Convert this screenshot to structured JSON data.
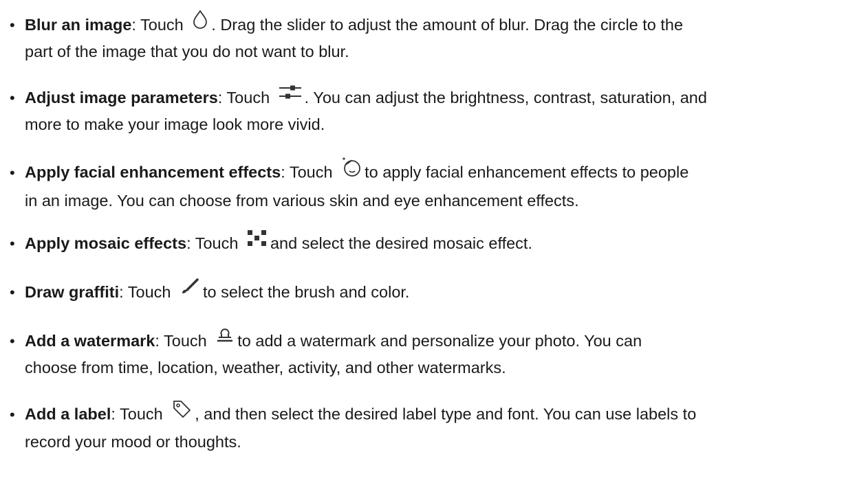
{
  "items": [
    {
      "title": "Blur an image",
      "before_icon": ": Touch",
      "icon": "droplet-icon",
      "after_icon": ". Drag the slider to adjust the amount of blur. Drag the circle to the",
      "continuation": "part of the image that you do not want to blur."
    },
    {
      "title": "Adjust image parameters",
      "before_icon": ": Touch",
      "icon": "sliders-icon",
      "after_icon": ". You can adjust the brightness, contrast, saturation, and",
      "continuation": "more to make your image look more vivid."
    },
    {
      "title": "Apply facial enhancement effects",
      "before_icon": ": Touch",
      "icon": "face-enhance-icon",
      "after_icon": "to apply facial enhancement effects to people",
      "continuation": "in an image. You can choose from various skin and eye enhancement effects."
    },
    {
      "title": "Apply mosaic effects",
      "before_icon": ": Touch",
      "icon": "mosaic-icon",
      "after_icon": "and select the desired mosaic effect.",
      "continuation": ""
    },
    {
      "title": "Draw graffiti",
      "before_icon": ": Touch",
      "icon": "brush-icon",
      "after_icon": "to select the brush and color.",
      "continuation": ""
    },
    {
      "title": "Add a watermark",
      "before_icon": ": Touch",
      "icon": "watermark-stamp-icon",
      "after_icon": "to add a watermark and personalize your photo. You can",
      "continuation": "choose from time, location, weather, activity, and other watermarks."
    },
    {
      "title": "Add a label",
      "before_icon": ": Touch",
      "icon": "tag-icon",
      "after_icon": ", and then select the desired label type and font. You can use labels to",
      "continuation": "record your mood or thoughts."
    }
  ]
}
